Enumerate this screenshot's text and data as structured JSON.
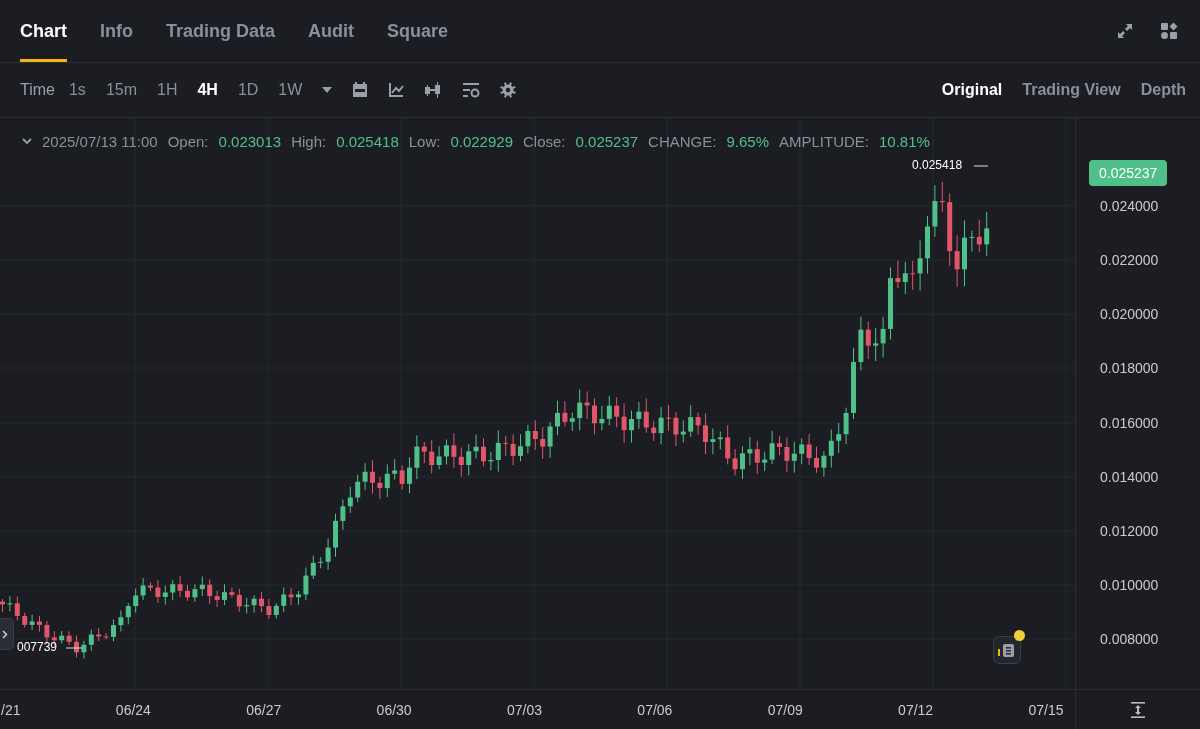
{
  "tabs": [
    {
      "label": "Chart",
      "selected": true
    },
    {
      "label": "Info",
      "selected": false
    },
    {
      "label": "Trading Data",
      "selected": false
    },
    {
      "label": "Audit",
      "selected": false
    },
    {
      "label": "Square",
      "selected": false
    }
  ],
  "toolbar": {
    "interval_label": "Time",
    "intervals": [
      {
        "label": "1s",
        "selected": false
      },
      {
        "label": "15m",
        "selected": false
      },
      {
        "label": "1H",
        "selected": false
      },
      {
        "label": "4H",
        "selected": true
      },
      {
        "label": "1D",
        "selected": false
      },
      {
        "label": "1W",
        "selected": false
      }
    ],
    "views": [
      {
        "label": "Original",
        "selected": true
      },
      {
        "label": "Trading View",
        "selected": false
      },
      {
        "label": "Depth",
        "selected": false
      }
    ]
  },
  "legend": {
    "date": "2025/07/13 11:00",
    "fields": [
      {
        "label": "Open:",
        "value": "0.023013"
      },
      {
        "label": "High:",
        "value": "0.025418"
      },
      {
        "label": "Low:",
        "value": "0.022929"
      },
      {
        "label": "Close:",
        "value": "0.025237"
      },
      {
        "label": "CHANGE:",
        "value": "9.65%"
      },
      {
        "label": "AMPLITUDE:",
        "value": "10.81%"
      }
    ]
  },
  "chart": {
    "high_marker": "0.025418",
    "low_marker": "007739",
    "last_price": "0.025237",
    "y_axis": [
      "0.024000",
      "0.022000",
      "0.020000",
      "0.018000",
      "0.016000",
      "0.014000",
      "0.012000",
      "0.010000",
      "0.008000"
    ],
    "x_axis": [
      "/21",
      "06/24",
      "06/27",
      "06/30",
      "07/03",
      "07/06",
      "07/09",
      "07/12",
      "07/15"
    ]
  }
}
